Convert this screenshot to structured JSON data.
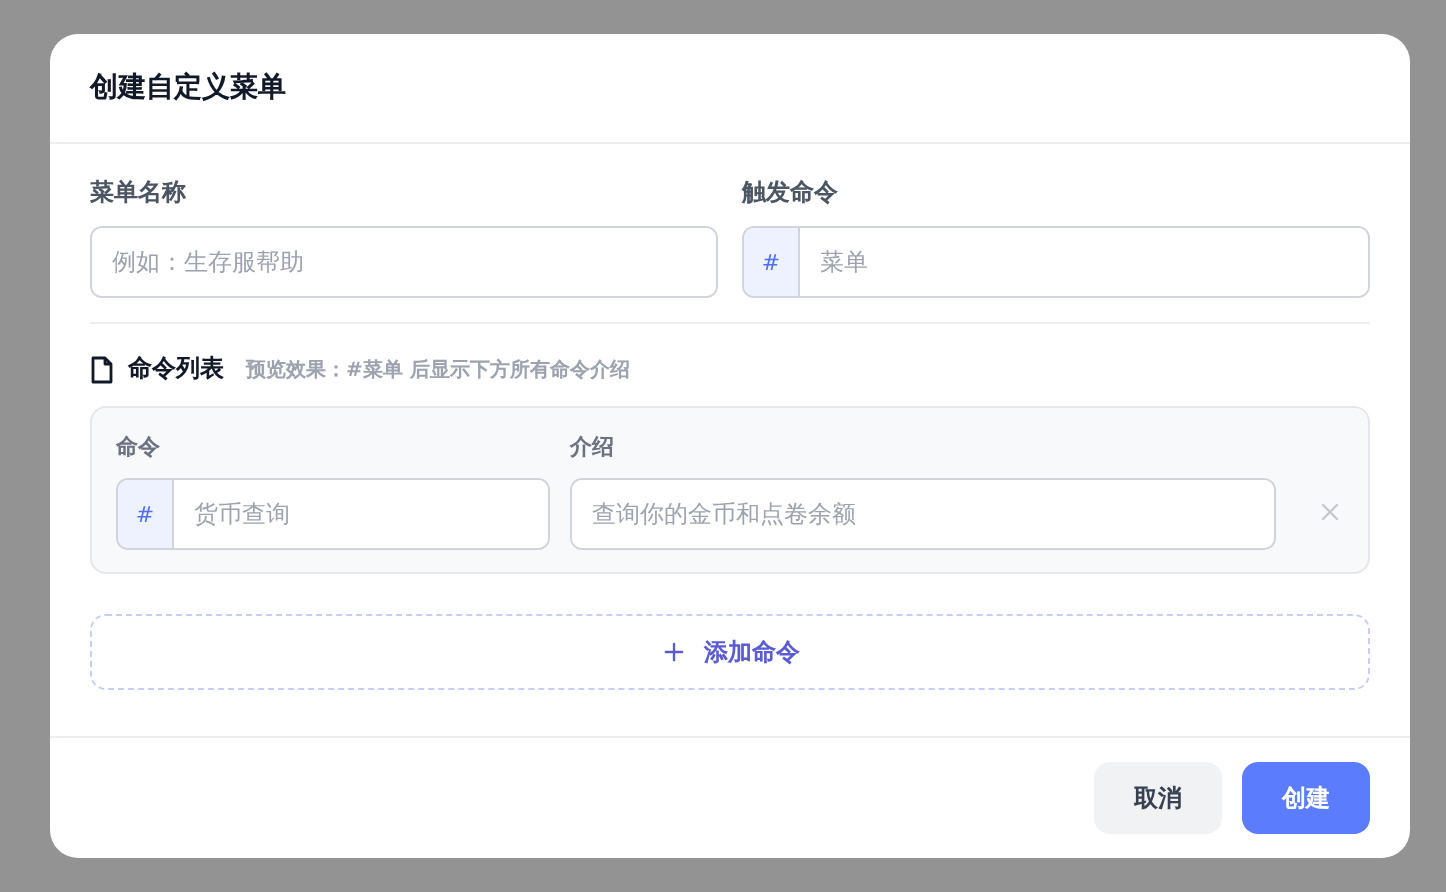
{
  "dialog": {
    "title": "创建自定义菜单"
  },
  "menu_name": {
    "label": "菜单名称",
    "placeholder": "例如：生存服帮助"
  },
  "trigger": {
    "label": "触发命令",
    "prefix": "#",
    "placeholder": "菜单"
  },
  "command_list": {
    "title": "命令列表",
    "hint": "预览效果：#菜单 后显示下方所有命令介绍",
    "command_label": "命令",
    "intro_label": "介绍",
    "rows": [
      {
        "prefix": "#",
        "command_placeholder": "货币查询",
        "intro_placeholder": "查询你的金币和点卷余额"
      }
    ],
    "add_button": "添加命令"
  },
  "buttons": [
    {
      "label": "取消",
      "kind": "secondary"
    },
    {
      "label": "创建",
      "kind": "primary"
    }
  ]
}
